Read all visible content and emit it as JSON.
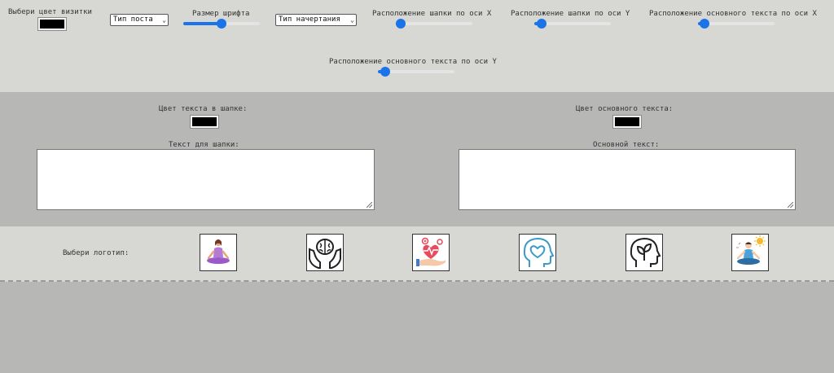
{
  "toolbar": {
    "card_color_label": "Выбери цвет визитки",
    "post_type_select": "Тип поста",
    "font_size_label": "Размер шрифта",
    "font_size_value": 0.5,
    "font_style_select": "Тип начертания",
    "header_x_label": "Расположение шапки по оси X",
    "header_x_value": 0.06,
    "header_y_label": "Расположение шапки по оси Y",
    "header_y_value": 0.1,
    "body_x_label": "Расположение основного текста по оси X",
    "body_x_value": 0.09,
    "body_y_label": "Расположение основного текста по оси Y",
    "body_y_value": 0.1
  },
  "editor": {
    "header_color_label": "Цвет текста в шапке:",
    "body_color_label": "Цвет основного текста:",
    "header_text_label": "Текст для шапки:",
    "header_text_value": "",
    "body_text_label": "Основной текст:",
    "body_text_value": ""
  },
  "logos": {
    "label": "Выбери логотип:",
    "items": [
      "yoga-woman-icon",
      "brain-hands-icon",
      "heart-care-hand-icon",
      "head-heart-icon",
      "head-leaf-icon",
      "meditation-sun-icon"
    ]
  },
  "colors": {
    "accent": "#1a73e8",
    "swatch": "#000000",
    "toolbar_bg": "#d7d7d3",
    "panel_bg": "#b7b7b5"
  }
}
